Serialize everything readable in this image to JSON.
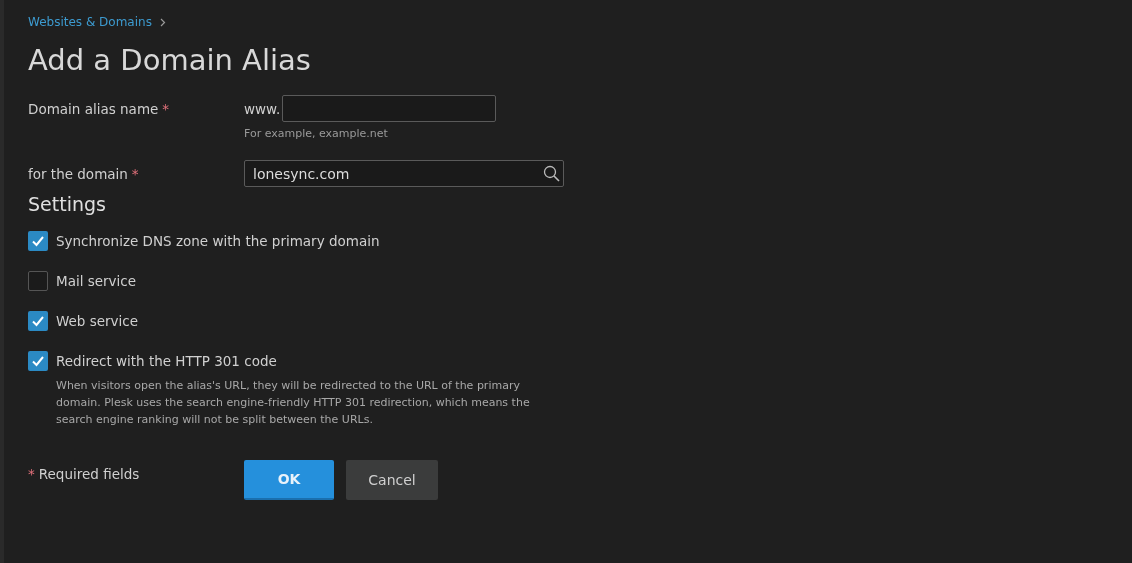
{
  "breadcrumb": {
    "items": [
      "Websites & Domains"
    ]
  },
  "title": "Add a Domain Alias",
  "fields": [
    {
      "kind": "prefixed",
      "label": "Domain alias name",
      "required_mark": "*",
      "prefix": "www.",
      "hint": "For example, example.net"
    },
    {
      "kind": "search",
      "label": "for the domain",
      "required_mark": "*",
      "value": "lonesync.com"
    }
  ],
  "settings": {
    "heading": "Settings",
    "options": [
      {
        "label": "Synchronize DNS zone with the primary domain",
        "checked": true
      },
      {
        "label": "Mail service",
        "checked": false
      },
      {
        "label": "Web service",
        "checked": true
      },
      {
        "label": "Redirect with the HTTP 301 code",
        "checked": true,
        "description": "When visitors open the alias's URL, they will be redirected to the URL of the primary domain. Plesk uses the search engine-friendly HTTP 301 redirection, which means the search engine ranking will not be split between the URLs."
      }
    ]
  },
  "footer": {
    "required_mark": "*",
    "required_note": "Required fields",
    "buttons": [
      {
        "label": "OK",
        "kind": "primary"
      },
      {
        "label": "Cancel",
        "kind": "secondary"
      }
    ]
  }
}
